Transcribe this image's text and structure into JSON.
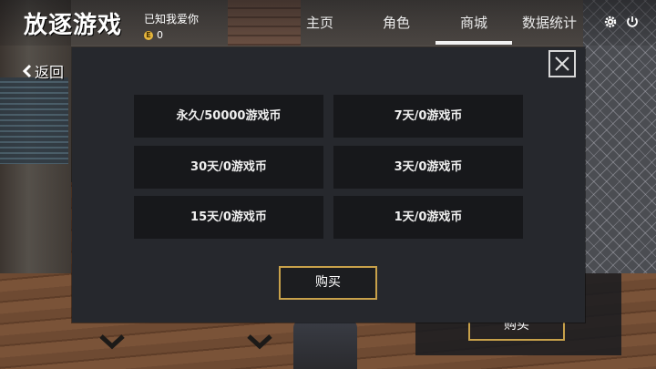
{
  "app": {
    "logo_text": "放逐游戏"
  },
  "user": {
    "name": "已知我爱你",
    "coins": "0",
    "coin_badge": "E"
  },
  "nav": {
    "items": [
      {
        "label": "主页",
        "active": false
      },
      {
        "label": "角色",
        "active": false
      },
      {
        "label": "商城",
        "active": true
      },
      {
        "label": "数据统计",
        "active": false
      }
    ]
  },
  "header_icons": [
    "settings-gear-icon",
    "power-icon"
  ],
  "back": {
    "label": "返回"
  },
  "modal": {
    "options": [
      {
        "label": "永久/50000游戏币"
      },
      {
        "label": "7天/0游戏币"
      },
      {
        "label": "30天/0游戏币"
      },
      {
        "label": "3天/0游戏币"
      },
      {
        "label": "15天/0游戏币"
      },
      {
        "label": "1天/0游戏币"
      }
    ],
    "buy_label": "购买"
  },
  "background": {
    "buy_label": "购买"
  },
  "colors": {
    "accent_gold": "#c8a14a",
    "modal_bg": "#26282d",
    "option_bg": "#17181b"
  }
}
